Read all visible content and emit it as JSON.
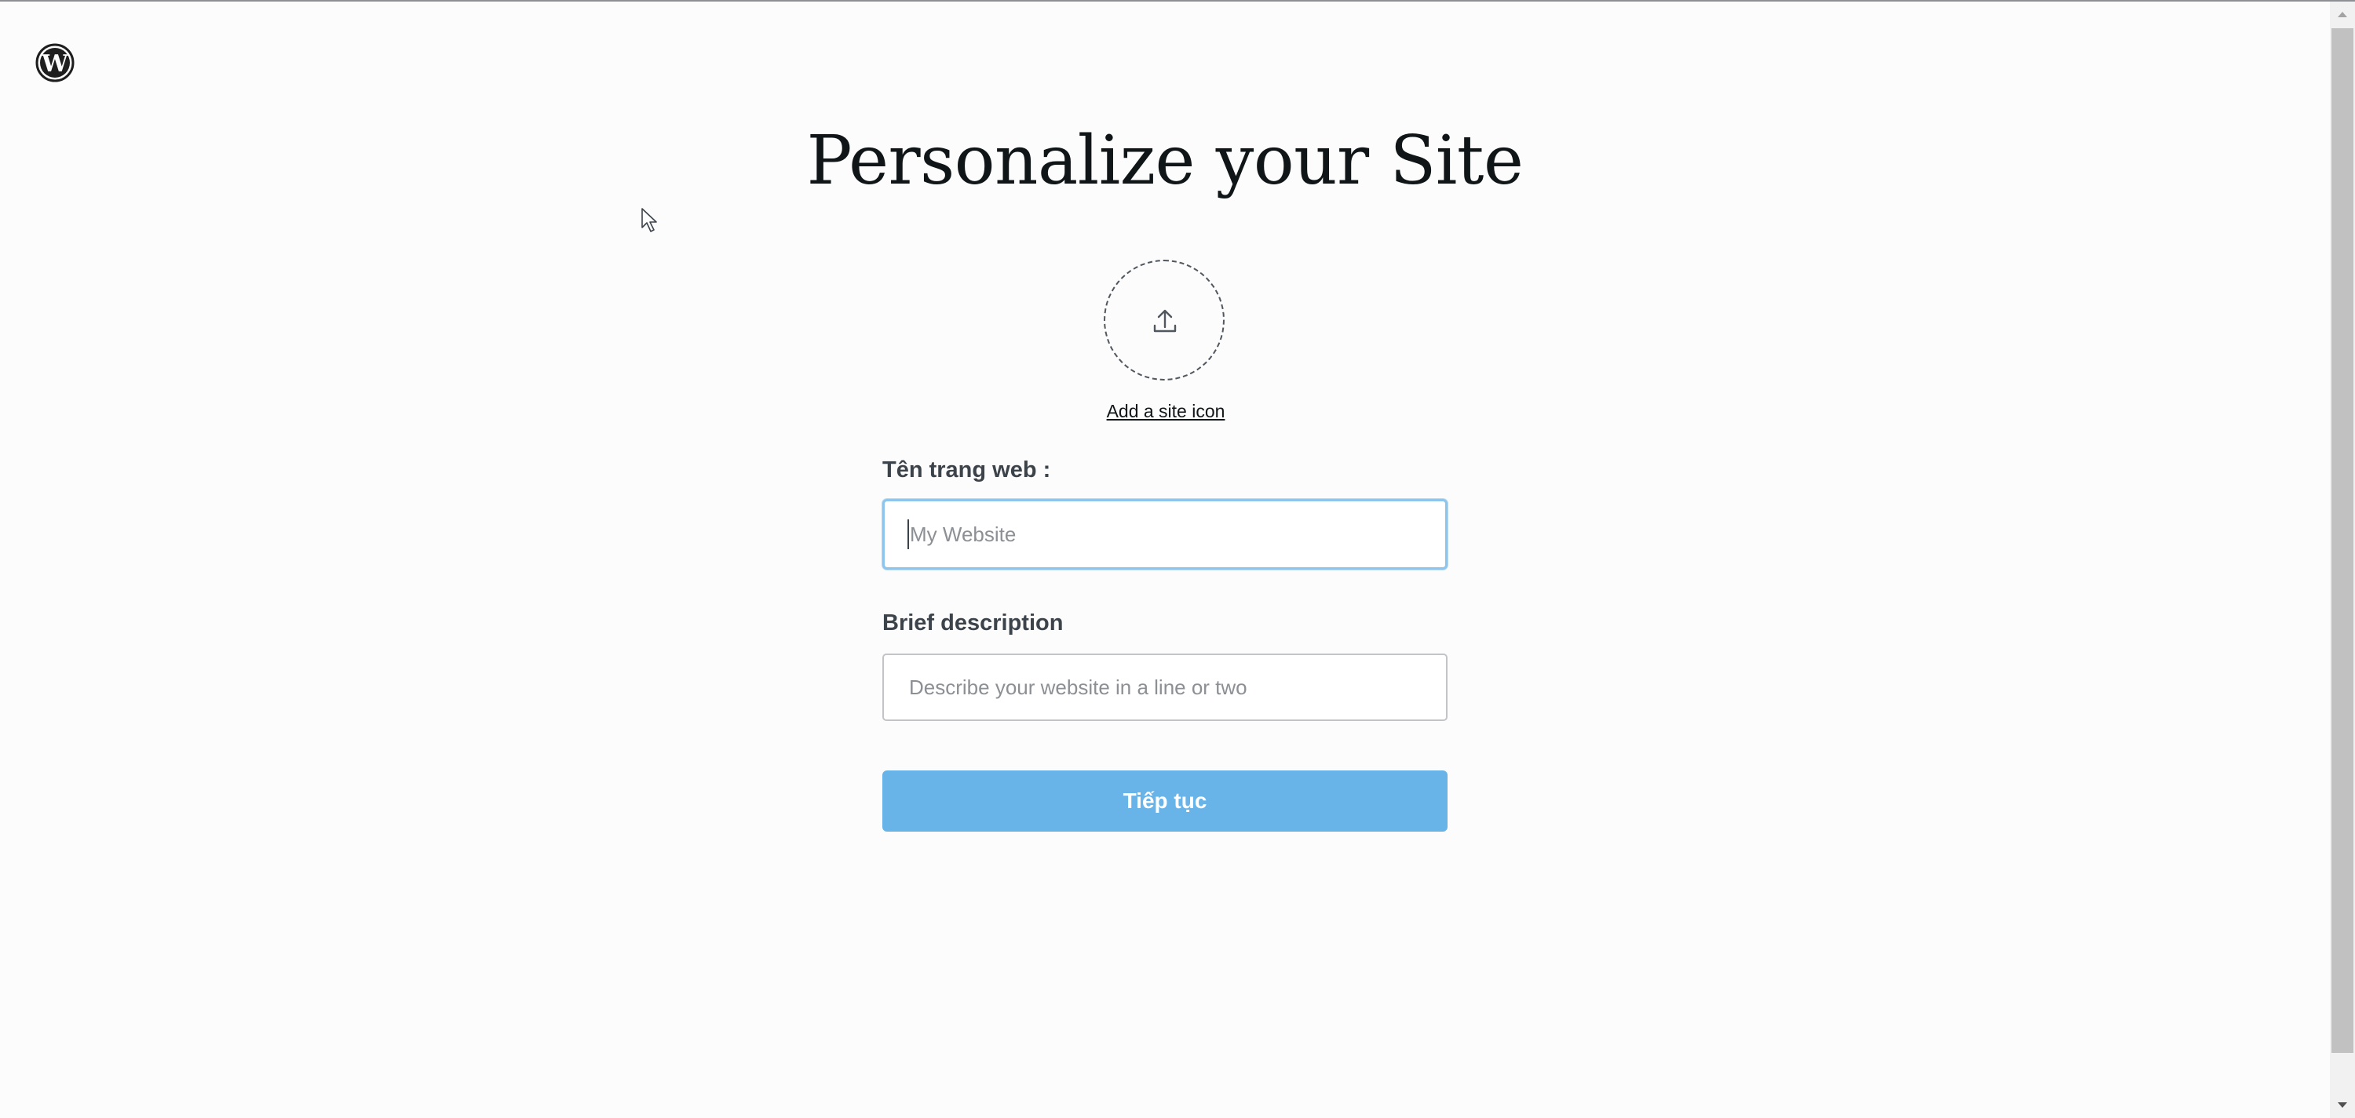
{
  "header": {
    "logo_icon": "wordpress-logo-icon"
  },
  "main": {
    "title": "Personalize your Site",
    "site_icon": {
      "icon": "upload-icon",
      "link_label": "Add a site icon"
    },
    "site_name": {
      "label": "Tên trang web :",
      "placeholder": "My Website",
      "value": ""
    },
    "description": {
      "label": "Brief description",
      "placeholder": "Describe your website in a line or two",
      "value": ""
    },
    "continue_label": "Tiếp tục"
  },
  "colors": {
    "background": "#fcfcfc",
    "title": "#101517",
    "text": "#3c434a",
    "focus_border": "#8ec5ec",
    "button": "#68b3e8",
    "button_text": "#ffffff"
  }
}
